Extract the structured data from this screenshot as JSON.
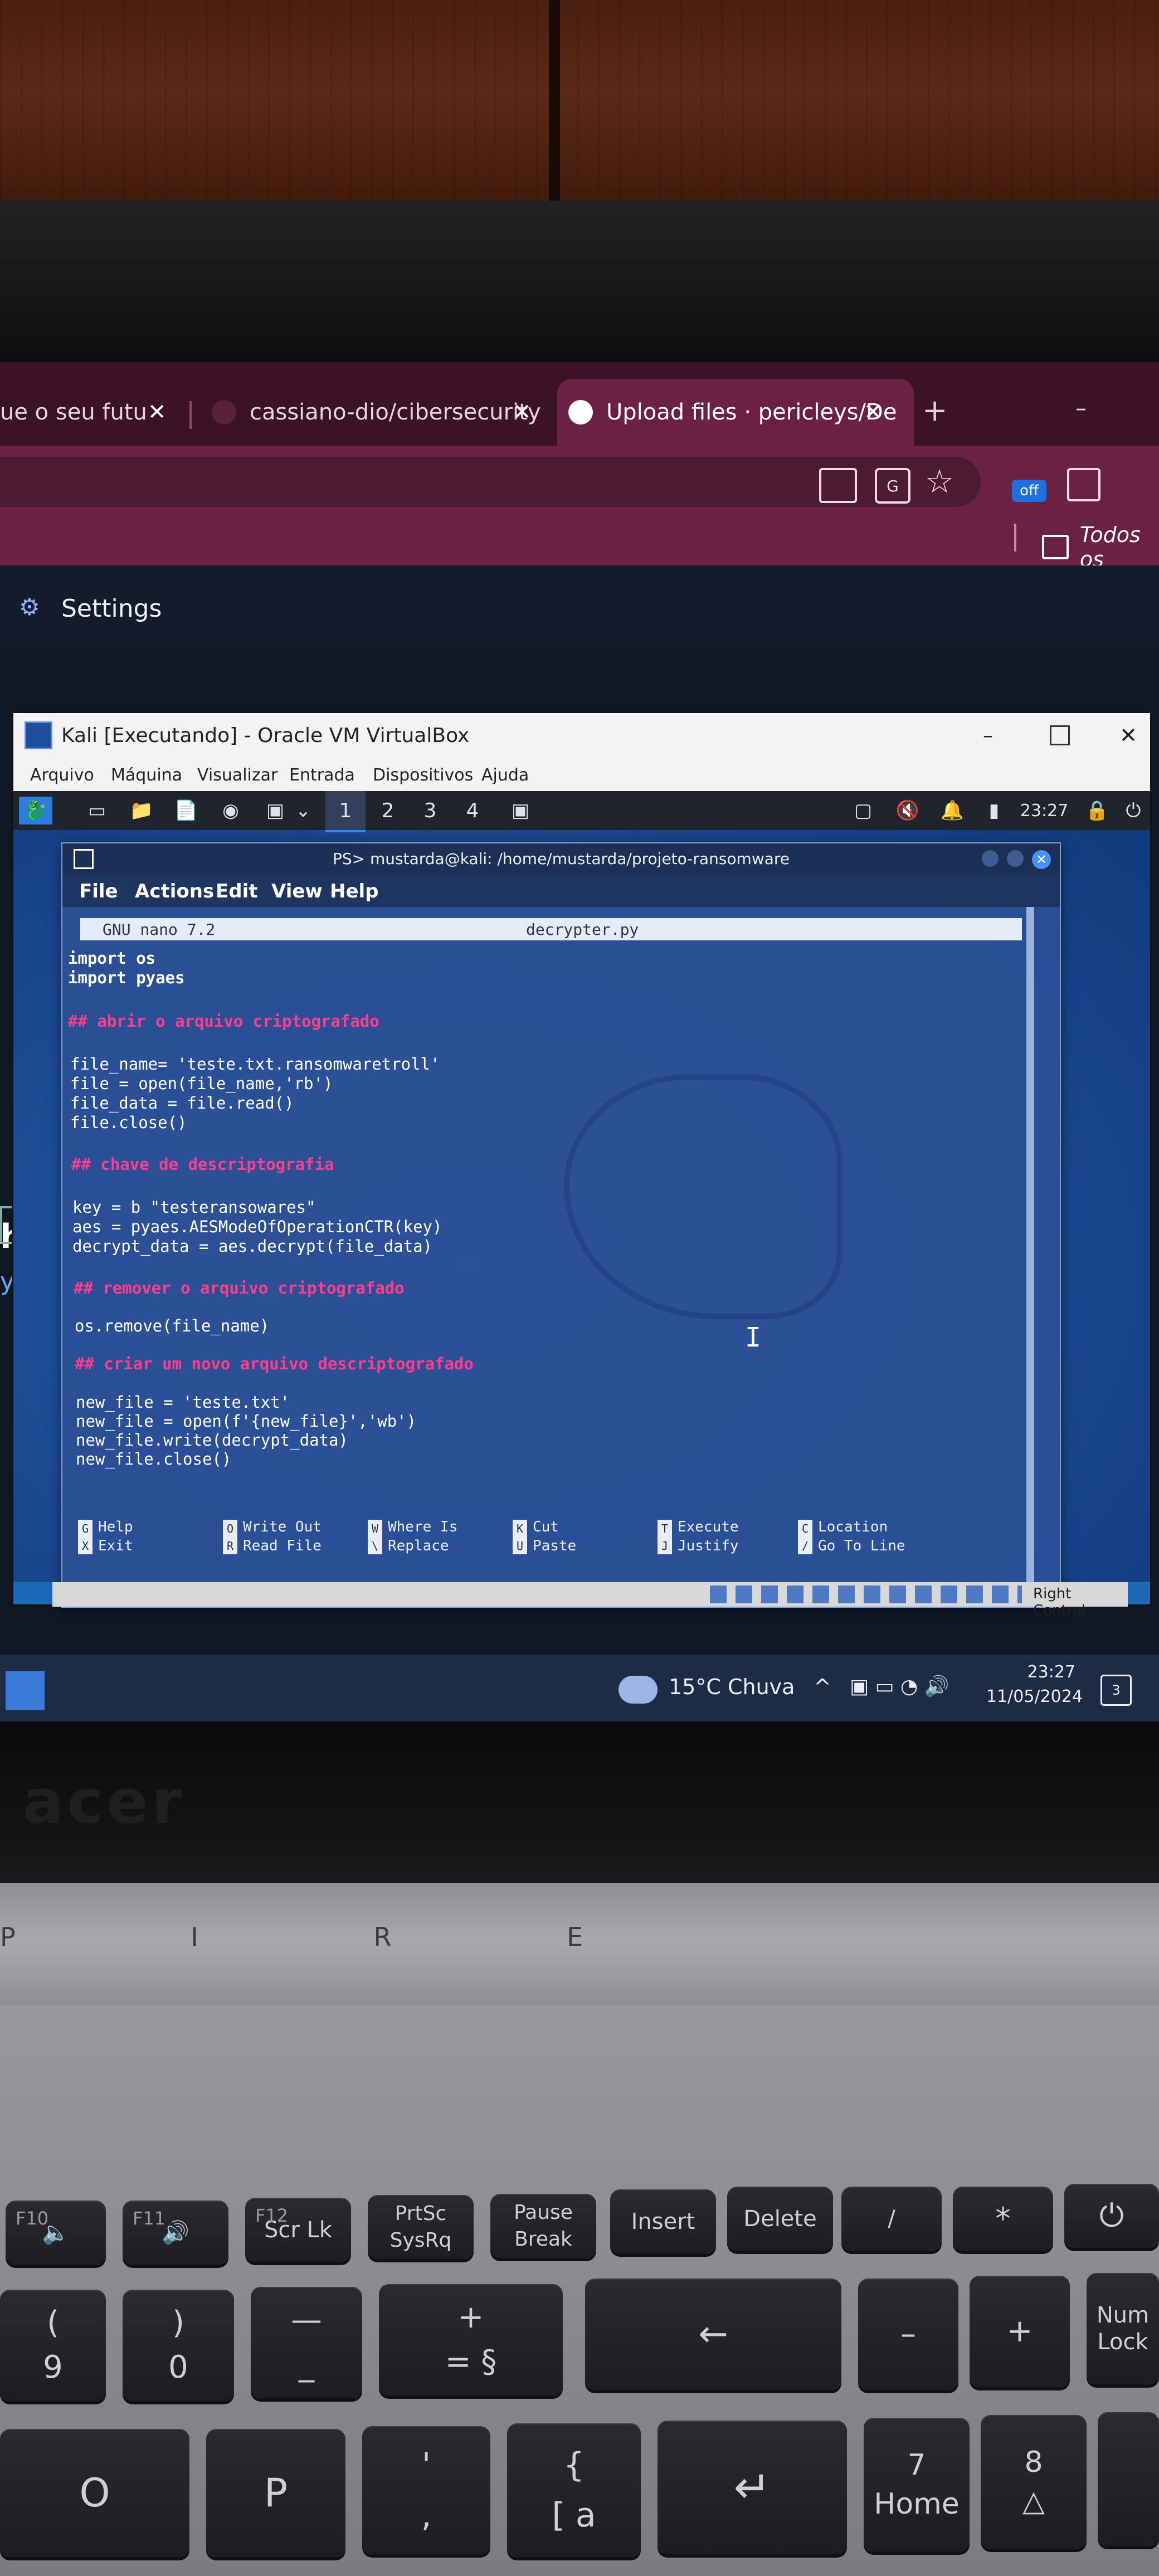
{
  "browser": {
    "tabs": [
      {
        "label": "ue o seu futu"
      },
      {
        "label": "cassiano-dio/cibersecurity"
      },
      {
        "label": "Upload files · pericleys/De"
      }
    ],
    "new_tab": "+",
    "bookmark_folder": "Todos os",
    "extension_badge": "off",
    "settings_label": "Settings"
  },
  "page": {
    "partial_heading": "he",
    "partial_text": "yc"
  },
  "vbox": {
    "title": "Kali [Executando] - Oracle VM VirtualBox",
    "menu": [
      "Arquivo",
      "Máquina",
      "Visualizar",
      "Entrada",
      "Dispositivos",
      "Ajuda"
    ],
    "status_host_key": "Right Control"
  },
  "kali_panel": {
    "workspaces": [
      "1",
      "2",
      "3",
      "4"
    ],
    "time": "23:27"
  },
  "terminal": {
    "title": "PS> mustarda@kali: /home/mustarda/projeto-ransomware",
    "menu": [
      "File",
      "Actions",
      "Edit",
      "View",
      "Help"
    ],
    "nano_version": "GNU nano 7.2",
    "filename": "decrypter.py",
    "code": [
      {
        "text": "import os",
        "type": "code"
      },
      {
        "text": "import pyaes",
        "type": "code"
      },
      {
        "text": "## abrir o arquivo criptografado",
        "type": "comment"
      },
      {
        "text": "file_name= 'teste.txt.ransomwaretroll'",
        "type": "code"
      },
      {
        "text": "file = open(file_name,'rb')",
        "type": "code"
      },
      {
        "text": "file_data = file.read()",
        "type": "code"
      },
      {
        "text": "file.close()",
        "type": "code"
      },
      {
        "text": "## chave de descriptografia",
        "type": "comment"
      },
      {
        "text": "key = b \"testeransowares\"",
        "type": "code"
      },
      {
        "text": "aes = pyaes.AESModeOfOperationCTR(key)",
        "type": "code"
      },
      {
        "text": "decrypt_data = aes.decrypt(file_data)",
        "type": "code"
      },
      {
        "text": "## remover o arquivo criptografado",
        "type": "comment"
      },
      {
        "text": "os.remove(file_name)",
        "type": "code"
      },
      {
        "text": "## criar um novo arquivo descriptografado",
        "type": "comment"
      },
      {
        "text": "new_file = 'teste.txt'",
        "type": "code"
      },
      {
        "text": "new_file = open(f'{new_file}','wb')",
        "type": "code"
      },
      {
        "text": "new_file.write(decrypt_data)",
        "type": "code"
      },
      {
        "text": "new_file.close()",
        "type": "code"
      }
    ],
    "shortcuts": [
      {
        "top": "Help",
        "bottom": "Exit",
        "key_top": "G",
        "key_bottom": "X"
      },
      {
        "top": "Write Out",
        "bottom": "Read File",
        "key_top": "O",
        "key_bottom": "R"
      },
      {
        "top": "Where Is",
        "bottom": "Replace",
        "key_top": "W",
        "key_bottom": "\\"
      },
      {
        "top": "Cut",
        "bottom": "Paste",
        "key_top": "K",
        "key_bottom": "U"
      },
      {
        "top": "Execute",
        "bottom": "Justify",
        "key_top": "T",
        "key_bottom": "J"
      },
      {
        "top": "Location",
        "bottom": "Go To Line",
        "key_top": "C",
        "key_bottom": "/"
      }
    ]
  },
  "taskbar": {
    "weather": "15°C  Chuva",
    "time": "23:27",
    "date": "11/05/2024",
    "notification_count": "3"
  },
  "laptop": {
    "brand": "acer",
    "model_text": "P I R E"
  },
  "keyboard": {
    "row1": [
      {
        "tl": "F10",
        "main": "🔈"
      },
      {
        "tl": "F11",
        "main": "🔊"
      },
      {
        "tl": "F12",
        "main": "Scr Lk"
      },
      {
        "tl": "",
        "main": "PrtSc\nSysRq"
      },
      {
        "tl": "",
        "main": "Pause\nBreak"
      },
      {
        "tl": "",
        "main": "Insert"
      },
      {
        "tl": "",
        "main": "Delete"
      },
      {
        "tl": "",
        "main": "/"
      },
      {
        "tl": "",
        "main": "*"
      },
      {
        "tl": "",
        "main": "⏻"
      }
    ],
    "row2": [
      {
        "main": "(\n9"
      },
      {
        "main": ")\n0"
      },
      {
        "main": "—\n_"
      },
      {
        "main": "+\n=   §"
      },
      {
        "main": "←"
      },
      {
        "main": "–"
      },
      {
        "main": "+"
      },
      {
        "main": "Num\nLock"
      }
    ],
    "row3": [
      {
        "main": "O"
      },
      {
        "main": "P"
      },
      {
        "main": "'\n,"
      },
      {
        "main": "{\n[   a"
      },
      {
        "main": "↵"
      },
      {
        "main": "7\nHome"
      },
      {
        "main": "8\n△"
      }
    ]
  }
}
